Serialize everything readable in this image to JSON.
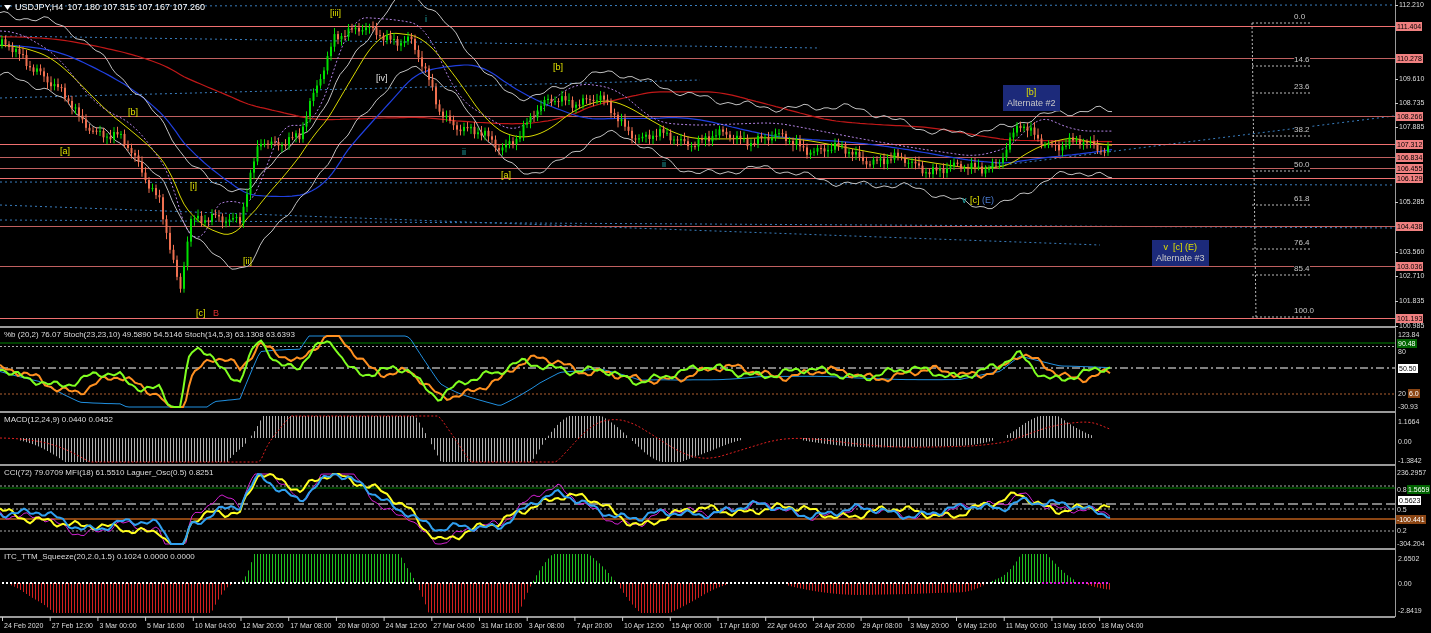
{
  "chart_header": {
    "title": "USDJPY,H4",
    "ohlc": "107.180 107.315 107.167 107.260"
  },
  "price_axis": {
    "ticks": [
      "112.210",
      "109.610",
      "108.735",
      "107.885",
      "105.285",
      "103.560",
      "102.710",
      "101.835",
      "100.985"
    ]
  },
  "level_lines": [
    {
      "price": "111.404"
    },
    {
      "price": "110.278"
    },
    {
      "price": "108.266"
    },
    {
      "price": "107.312"
    },
    {
      "price": "106.834"
    },
    {
      "price": "106.455"
    },
    {
      "price": "106.129"
    },
    {
      "price": "104.438"
    },
    {
      "price": "103.036"
    },
    {
      "price": "101.193"
    }
  ],
  "fib_levels": [
    "0.0",
    "14.6",
    "23.6",
    "38.2",
    "50.0",
    "61.8",
    "76.4",
    "85.4",
    "100.0"
  ],
  "wave_labels": [
    {
      "text": "[iii]",
      "kind": "minor"
    },
    {
      "text": "i",
      "kind": "minute"
    },
    {
      "text": "[iv]",
      "kind": "plain"
    },
    {
      "text": "[b]",
      "kind": "minor"
    },
    {
      "text": "[b]",
      "kind": "minor"
    },
    {
      "text": "[a]",
      "kind": "minor"
    },
    {
      "text": "ii",
      "kind": "minute"
    },
    {
      "text": "[a]",
      "kind": "minor"
    },
    {
      "text": "[i]",
      "kind": "minor"
    },
    {
      "text": "[ii]",
      "kind": "minor"
    },
    {
      "text": "[c]",
      "kind": "minor"
    },
    {
      "text": "B",
      "kind": "primary"
    },
    {
      "text": "ii",
      "kind": "minute"
    },
    {
      "text": "v",
      "kind": "minute"
    },
    {
      "text": "[c]",
      "kind": "minor"
    },
    {
      "text": "(E)",
      "kind": "intermediate"
    }
  ],
  "callouts": [
    {
      "label": "[b]",
      "caption": "Alternate #2"
    },
    {
      "label": "v  [c] (E)",
      "caption": "Alternate #3"
    }
  ],
  "panels": [
    {
      "legend": "%b (20,2) 76.07  Stoch(23,23,10) 49.5890 54.5146  Stoch(14,5,3) 63.1308 63.6393",
      "ticks": [
        "123.84",
        "80",
        "20",
        "-30.93"
      ],
      "badges": [
        {
          "text": "90.48",
          "color": "#006400"
        },
        {
          "text": "50.50",
          "color": "#ffffff"
        },
        {
          "text": "6.0",
          "color": "#8b4513"
        }
      ]
    },
    {
      "legend": "MACD(12,24,9) 0.0440 0.0452",
      "ticks": [
        "1.1664",
        "0.00",
        "-1.3842"
      ]
    },
    {
      "legend": "CCI(72) 79.0709  MFI(18) 61.5510  Laguer_Osc(0.5) 0.8251",
      "ticks": [
        "236.2957",
        "0.8",
        "0.5",
        "0.2",
        "-304.204"
      ],
      "badges": [
        {
          "text": "1.5659",
          "color": "#006400"
        },
        {
          "text": "0.5623",
          "color": "#ffffff"
        },
        {
          "text": "-100.441",
          "color": "#8b4513"
        }
      ]
    },
    {
      "legend": "ITC_TTM_Squeeze(20,2.0,1.5) 0.1024 0.0000 0.0000",
      "ticks": [
        "2.6502",
        "0.00",
        "-2.8419"
      ]
    }
  ],
  "time_axis": [
    "24 Feb 2020",
    "27 Feb 12:00",
    "3 Mar 00:00",
    "5 Mar 16:00",
    "10 Mar 04:00",
    "12 Mar 20:00",
    "17 Mar 08:00",
    "20 Mar 00:00",
    "24 Mar 12:00",
    "27 Mar 04:00",
    "31 Mar 16:00",
    "3 Apr 08:00",
    "7 Apr 20:00",
    "10 Apr 12:00",
    "15 Apr 00:00",
    "17 Apr 16:00",
    "22 Apr 04:00",
    "24 Apr 20:00",
    "29 Apr 08:00",
    "3 May 20:00",
    "6 May 12:00",
    "11 May 00:00",
    "13 May 16:00",
    "18 May 04:00"
  ]
}
